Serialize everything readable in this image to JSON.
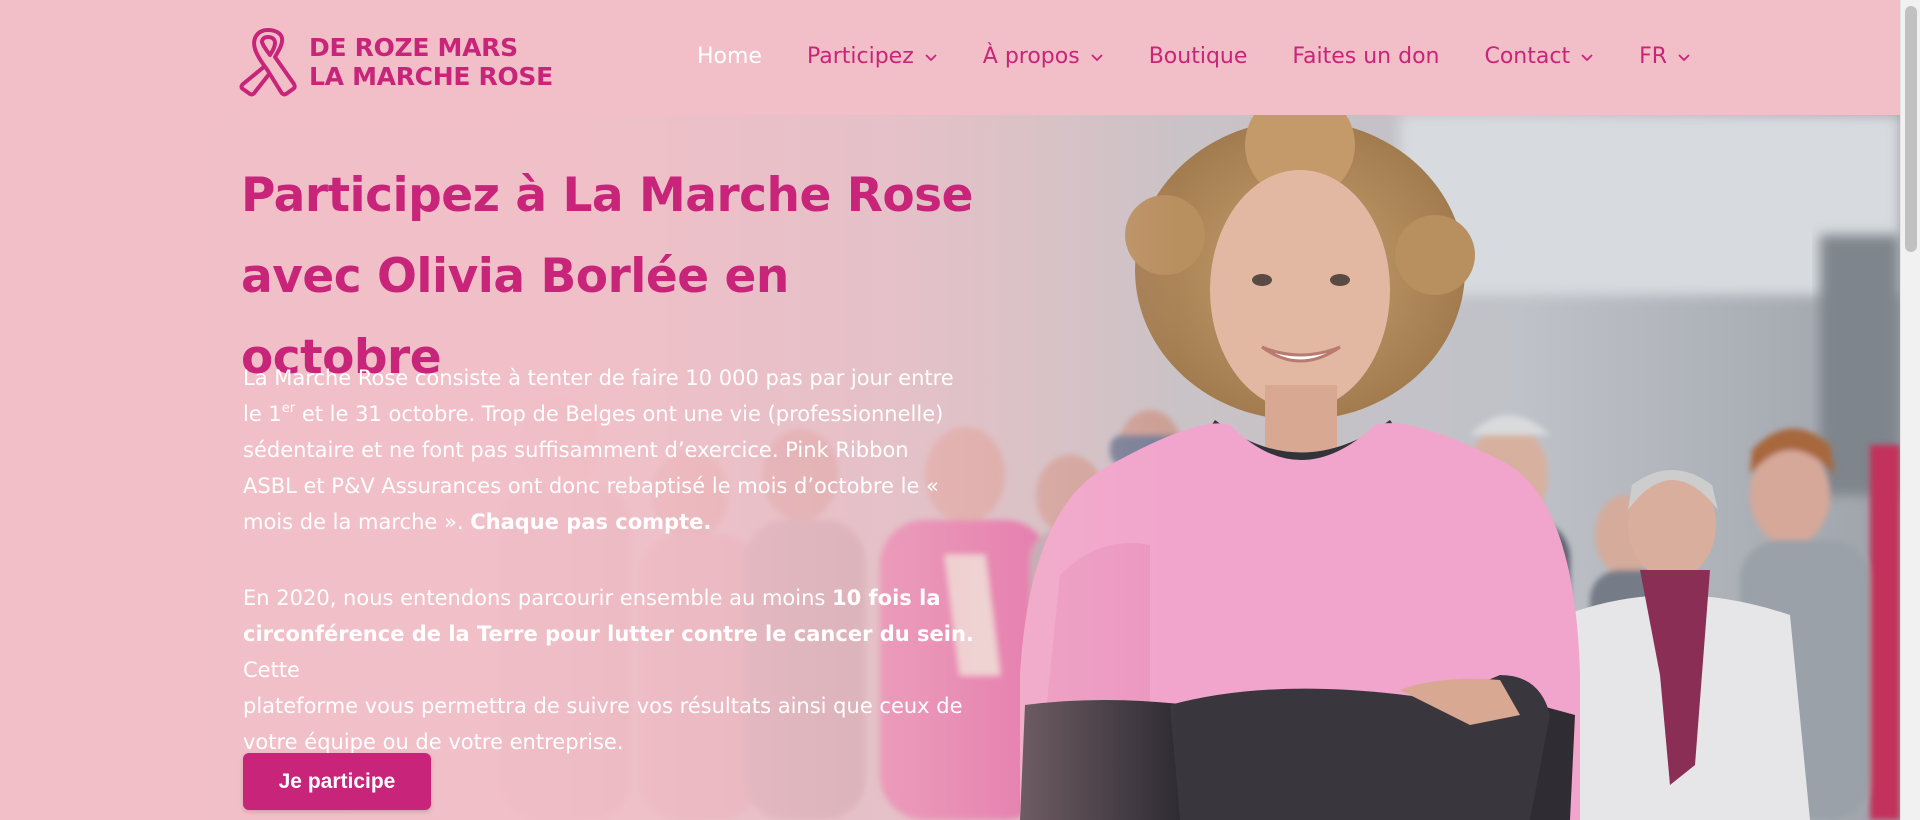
{
  "brand": {
    "line1": "DE ROZE MARS",
    "line2": "LA MARCHE ROSE",
    "ribbon_icon": "pink-ribbon-icon",
    "color": "#c8247a"
  },
  "nav": {
    "items": [
      {
        "label": "Home",
        "active": true,
        "dropdown": false
      },
      {
        "label": "Participez",
        "active": false,
        "dropdown": true
      },
      {
        "label": "À propos",
        "active": false,
        "dropdown": true
      },
      {
        "label": "Boutique",
        "active": false,
        "dropdown": false
      },
      {
        "label": "Faites un don",
        "active": false,
        "dropdown": false
      },
      {
        "label": "Contact",
        "active": false,
        "dropdown": true
      },
      {
        "label": "FR",
        "active": false,
        "dropdown": true
      }
    ]
  },
  "hero": {
    "title_line1": "Participez à La Marche Rose",
    "title_line2": "avec Olivia Borlée en octobre",
    "p1": {
      "line1": "La Marche Rose consiste à tenter de faire 10 000 pas par jour entre",
      "line2_a": "le 1",
      "line2_sup": "er",
      "line2_b": " et le 31 octobre. Trop de Belges ont une vie (professionnelle)",
      "line3": "sédentaire et ne font pas suffisamment d’exercice. Pink Ribbon",
      "line4": "ASBL et P&V Assurances ont donc rebaptisé le mois d’octobre le «",
      "line5": "mois de la marche ». ",
      "line5_bold": "Chaque pas compte."
    },
    "p2": {
      "line1": "En 2020, nous entendons parcourir ensemble au moins ",
      "line1_bold": "10 fois la",
      "line2_bold": "circonférence de la Terre pour lutter contre le cancer du sein.",
      "line2": " Cette",
      "line3": "plateforme vous permettra de suivre vos résultats ainsi que ceux de",
      "line4": "votre équipe ou de votre entreprise."
    },
    "cta_label": "Je participe"
  },
  "colors": {
    "background": "#f2bfc8",
    "accent": "#c8247a",
    "text_light": "#ffffff"
  }
}
